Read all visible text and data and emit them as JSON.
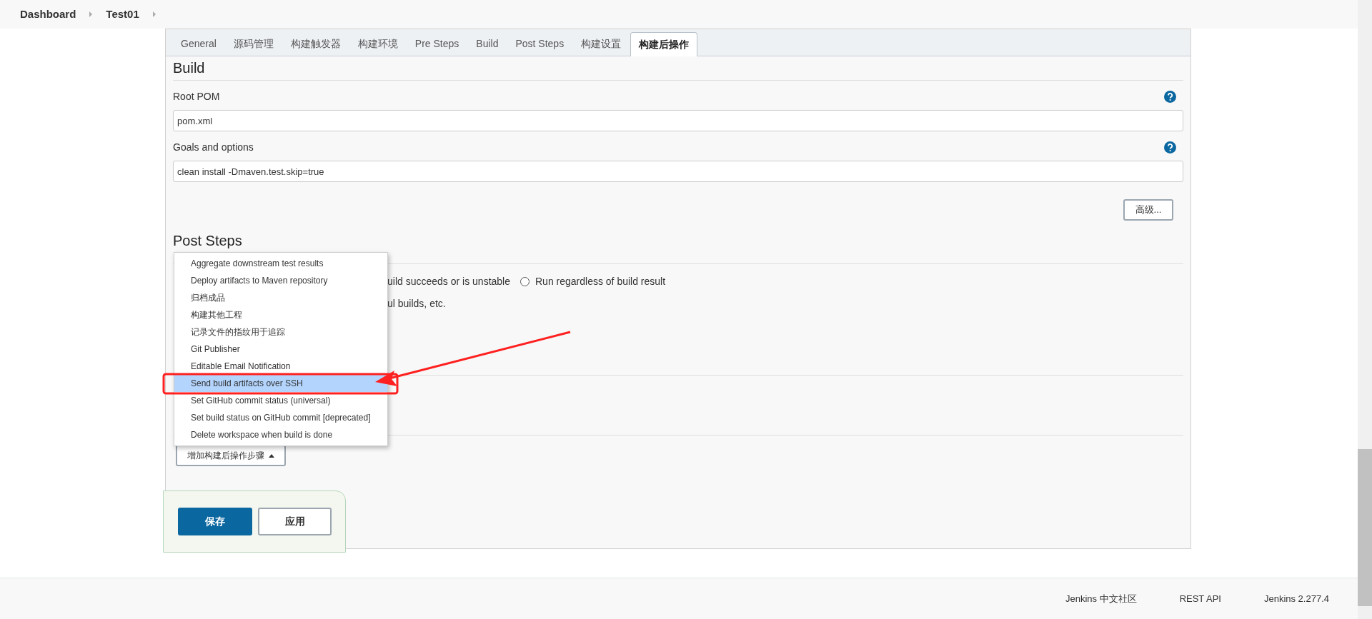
{
  "breadcrumbs": [
    {
      "label": "Dashboard"
    },
    {
      "label": "Test01"
    }
  ],
  "tabs": [
    {
      "label": "General",
      "selected": false
    },
    {
      "label": "源码管理",
      "selected": false
    },
    {
      "label": "构建触发器",
      "selected": false
    },
    {
      "label": "构建环境",
      "selected": false
    },
    {
      "label": "Pre Steps",
      "selected": false
    },
    {
      "label": "Build",
      "selected": false
    },
    {
      "label": "Post Steps",
      "selected": false
    },
    {
      "label": "构建设置",
      "selected": false
    },
    {
      "label": "构建后操作",
      "selected": true
    }
  ],
  "build": {
    "title": "Build",
    "fields": [
      {
        "label": "Root POM",
        "value": "pom.xml"
      },
      {
        "label": "Goals and options",
        "value": "clean install -Dmaven.test.skip=true"
      }
    ],
    "advanced_button": "高级..."
  },
  "post_steps": {
    "title": "Post Steps",
    "condition_text": "uild succeeds or is unstable",
    "radio": {
      "label": "Run regardless of build result",
      "selected": false
    },
    "note": "ul builds, etc."
  },
  "add_step_menu": {
    "items": [
      {
        "label": "Aggregate downstream test results",
        "selected": false
      },
      {
        "label": "Deploy artifacts to Maven repository",
        "selected": false
      },
      {
        "label": "归档成品",
        "selected": false
      },
      {
        "label": "构建其他工程",
        "selected": false
      },
      {
        "label": "记录文件的指纹用于追踪",
        "selected": false
      },
      {
        "label": "Git Publisher",
        "selected": false
      },
      {
        "label": "Editable Email Notification",
        "selected": false
      },
      {
        "label": "Send build artifacts over SSH",
        "selected": true
      },
      {
        "label": "Set GitHub commit status (universal)",
        "selected": false
      },
      {
        "label": "Set build status on GitHub commit [deprecated]",
        "selected": false
      },
      {
        "label": "Delete workspace when build is done",
        "selected": false
      }
    ]
  },
  "add_step_button": "增加构建后操作步骤",
  "save_button": "保存",
  "apply_button": "应用",
  "footer": [
    "Jenkins 中文社区",
    "REST API",
    "Jenkins 2.277.4"
  ]
}
